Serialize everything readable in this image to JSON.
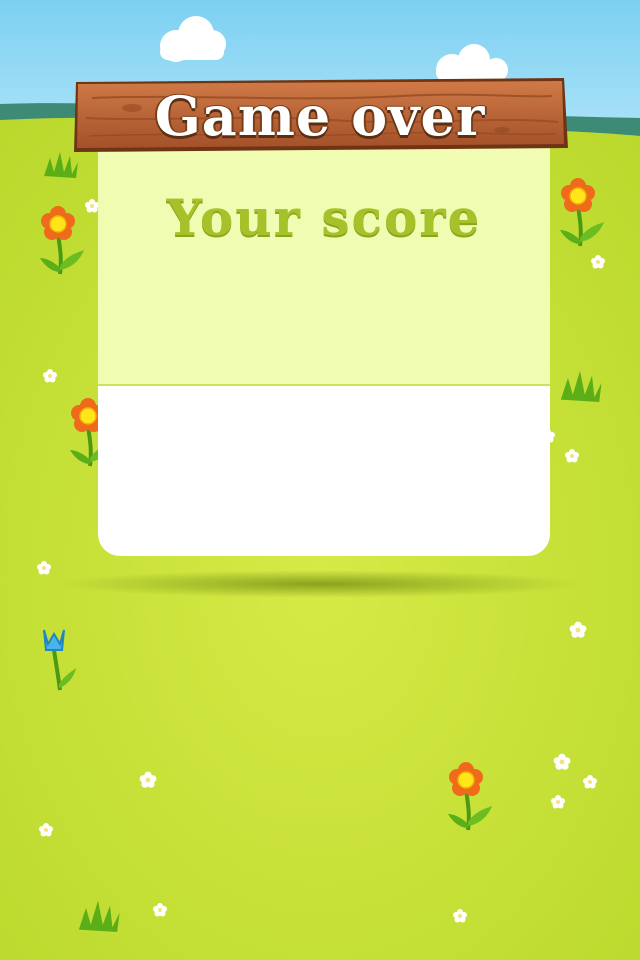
{
  "screen": {
    "title": "Game over",
    "score_heading": "Your score",
    "score_value": ""
  },
  "colors": {
    "sky": "#8fd6f2",
    "grass": "#c9e23a",
    "wood": "#b8643a",
    "panel_top": "#f0fcb2",
    "panel_bottom": "#ffffff",
    "score_text": "#a6c22a"
  },
  "decorations": {
    "icons": [
      "cloud-icon",
      "flower-icon",
      "tulip-icon",
      "daisy-icon",
      "grass-tuft-icon"
    ]
  }
}
